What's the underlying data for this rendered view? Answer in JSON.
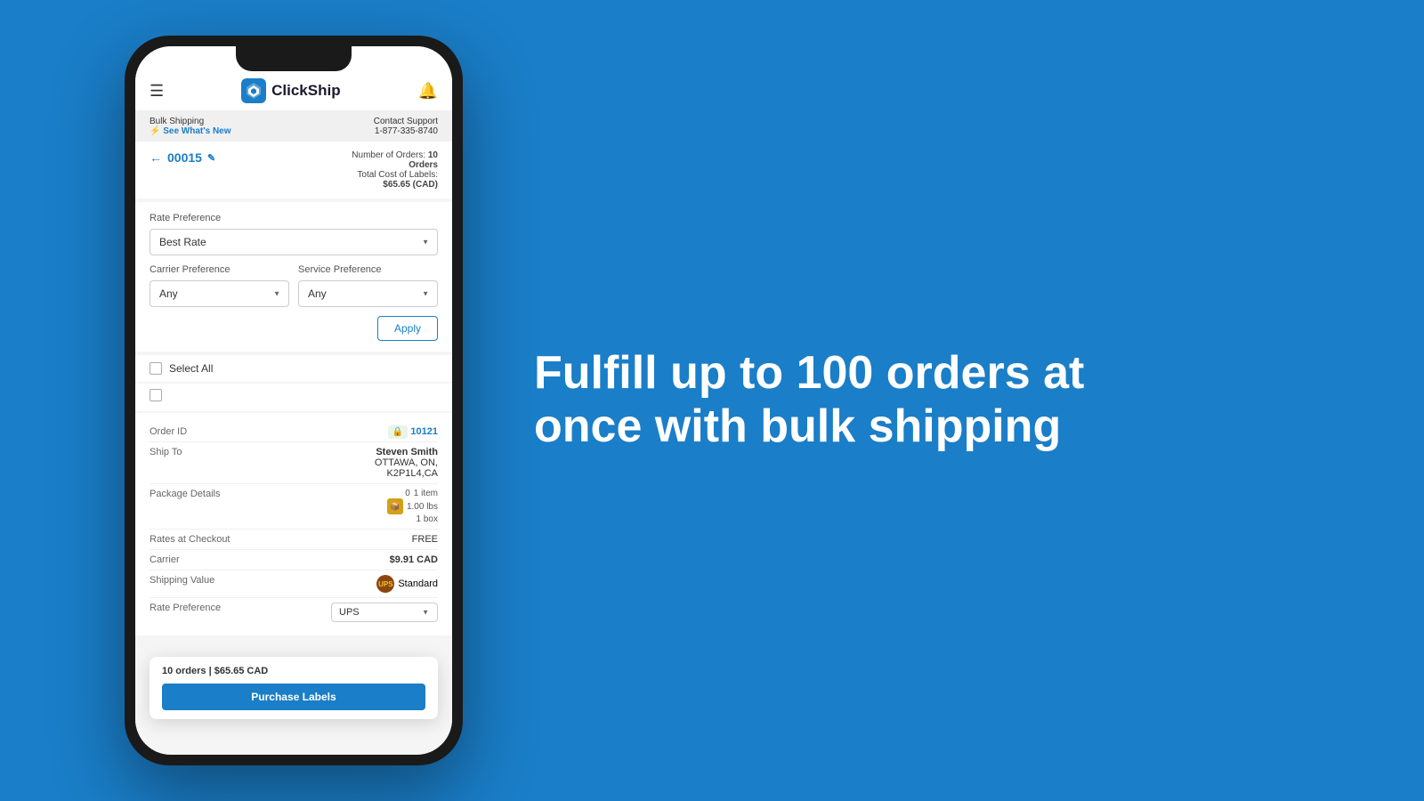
{
  "background_color": "#1a7ec8",
  "phone": {
    "header": {
      "logo_text": "ClickShip",
      "bell_label": "🔔"
    },
    "top_banner": {
      "bulk_shipping_label": "Bulk Shipping",
      "see_whats_new": "See What's New",
      "contact_support": "Contact Support",
      "phone_number": "1-877-335-8740"
    },
    "page_title": {
      "back_label": "←",
      "order_id": "00015",
      "edit_icon": "✎",
      "number_of_orders_label": "Number of Orders:",
      "number_of_orders_value": "10",
      "orders_label": "Orders",
      "total_cost_label": "Total Cost of Labels:",
      "total_cost_value": "$65.65 (CAD)"
    },
    "rate_section": {
      "rate_preference_label": "Rate Preference",
      "rate_preference_value": "Best Rate",
      "carrier_preference_label": "Carrier Preference",
      "carrier_preference_value": "Any",
      "service_preference_label": "Service Preference",
      "service_preference_value": "Any",
      "apply_button_label": "Apply"
    },
    "select_all": {
      "label": "Select All"
    },
    "order_card": {
      "order_id_label": "Order ID",
      "order_id_value": "10121",
      "ship_to_label": "Ship To",
      "ship_to_name": "Steven Smith",
      "ship_to_address": "OTTAWA, ON,",
      "ship_to_postal": "K2P1L4,CA",
      "package_details_label": "Package Details",
      "package_item_count": "1 item",
      "package_weight": "1.00 lbs",
      "package_boxes": "1 box",
      "rates_at_checkout_label": "Rates at Checkout",
      "rates_at_checkout_value": "FREE",
      "carrier_label": "Carrier",
      "carrier_value": "$9.91 CAD",
      "carrier_name": "Standard",
      "shipping_value_label": "Shipping Value",
      "rate_preference_label": "Rate Preference",
      "rate_preference_dropdown_value": "UPS"
    },
    "bottom_popup": {
      "orders_summary": "10 orders | $65.65 CAD",
      "purchase_button_label": "Purchase Labels"
    }
  },
  "right_panel": {
    "headline_line1": "Fulfill up to 100 orders at",
    "headline_line2": "once with bulk shipping"
  }
}
